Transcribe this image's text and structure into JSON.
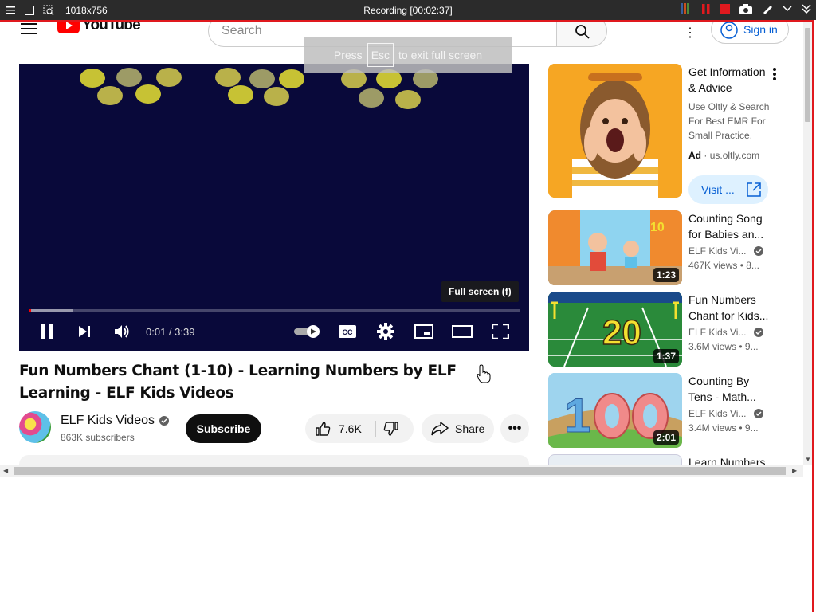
{
  "recorder": {
    "size_label": "1018x756",
    "title": "Recording [00:02:37]"
  },
  "header": {
    "logo_text": "YouTube",
    "search_placeholder": "Search",
    "signin_label": "Sign in"
  },
  "fullscreen_hint": {
    "prefix": "Press",
    "key": "Esc",
    "suffix": "to exit full screen"
  },
  "player": {
    "tooltip": "Full screen (f)",
    "time": "0:01 / 3:39",
    "progress_fraction": 0.0046,
    "buffer_fraction": 0.09,
    "autoplay": true,
    "dot_colors": [
      "#b9b14a",
      "#9d9b66",
      "#c7c234"
    ]
  },
  "video": {
    "title": "Fun Numbers Chant (1-10) - Learning Numbers by ELF Learning - ELF Kids Videos",
    "channel_name": "ELF Kids Videos",
    "subscribers": "863K subscribers",
    "subscribe_label": "Subscribe",
    "likes": "7.6K",
    "share_label": "Share"
  },
  "ad": {
    "title": "Get Information & Advice",
    "description": "Use Oltly & Search For Best EMR For Small Practice.",
    "ad_label": "Ad",
    "domain": "us.oltly.com",
    "visit_label": "Visit ..."
  },
  "recommendations": [
    {
      "title": "Counting Song for Babies an...",
      "channel": "ELF Kids Vi...",
      "views": "467K views",
      "extra": "• 8...",
      "duration": "1:23",
      "thumb_color": "#7ec8e8"
    },
    {
      "title": "Fun Numbers Chant for Kids...",
      "channel": "ELF Kids Vi...",
      "views": "3.6M views",
      "extra": "• 9...",
      "duration": "1:37",
      "thumb_color": "#2e8b3a"
    },
    {
      "title": "Counting By Tens - Math...",
      "channel": "ELF Kids Vi...",
      "views": "3.4M views",
      "extra": "• 9...",
      "duration": "2:01",
      "thumb_color": "#8fc8e8"
    },
    {
      "title": "Learn Numbers",
      "channel": "",
      "views": "",
      "extra": "",
      "duration": "",
      "thumb_color": "#e8eef4"
    }
  ],
  "colors": {
    "brand_red": "#ff0000",
    "recording_frame": "#e0191e",
    "player_bg": "#09093a",
    "link_blue": "#065fd4"
  }
}
